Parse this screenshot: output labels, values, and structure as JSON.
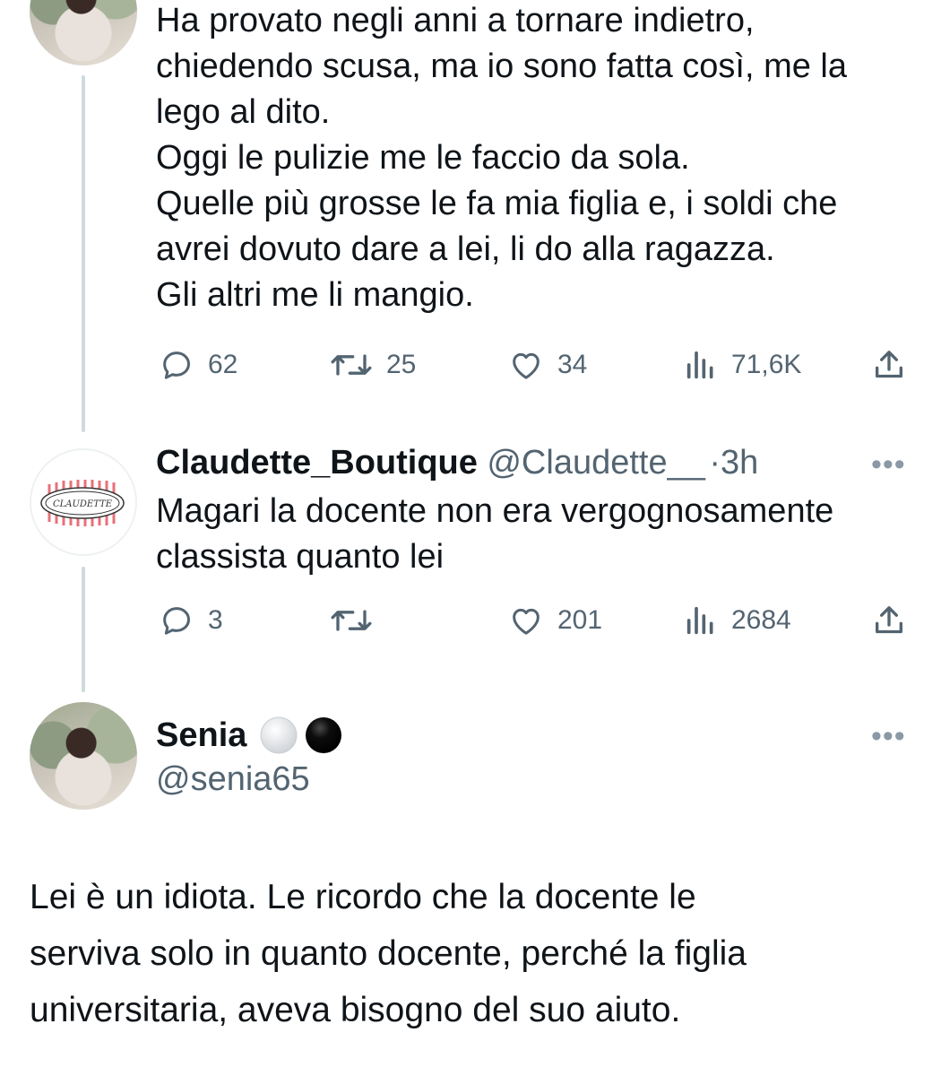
{
  "tweet1": {
    "text": "Ha provato negli anni a tornare indietro,\nchiedendo scusa, ma io sono fatta così, me la\nlego al dito.\nOggi le pulizie me le faccio da sola.\nQuelle più grosse le fa mia figlia e, i soldi che\navrei dovuto dare a lei, li do alla ragazza.\nGli altri me li mangio.",
    "replies": "62",
    "retweets": "25",
    "likes": "34",
    "views": "71,6K"
  },
  "tweet2": {
    "display_name": "Claudette_Boutique",
    "handle": "@Claudette__",
    "separator": "·",
    "time": "3h",
    "more": "•••",
    "logo_text": "CLAUDETTE",
    "text": "Magari la docente non era vergognosamente\nclassista quanto lei",
    "replies": "3",
    "retweets": "",
    "likes": "201",
    "views": "2684"
  },
  "main_tweet": {
    "display_name": "Senia",
    "handle": "@senia65",
    "more": "•••",
    "badges": [
      "white-circle-emoji",
      "black-circle-emoji"
    ],
    "text": "Lei è un idiota. Le ricordo che la docente le\nserviva solo in quanto docente, perché la figlia\nuniversitaria, aveva bisogno del suo aiuto."
  },
  "colors": {
    "text": "#0f1419",
    "secondary": "#536471",
    "thread_line": "#cfd9de",
    "logo_pink": "#e8707a"
  }
}
